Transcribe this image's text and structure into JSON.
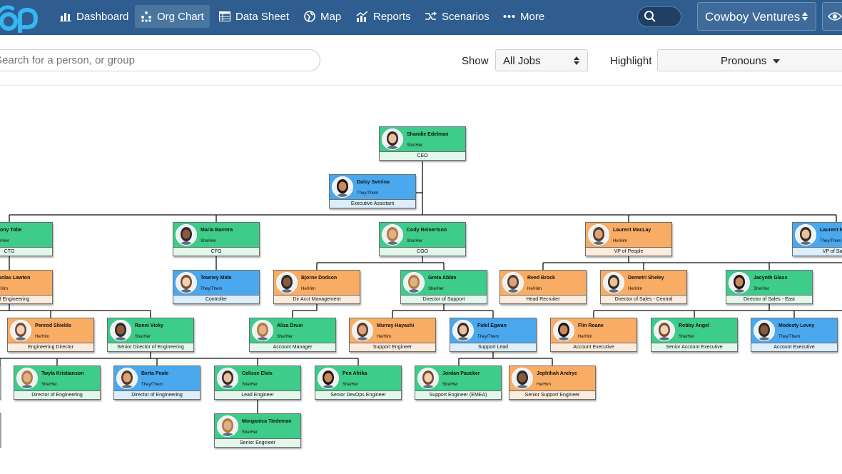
{
  "nav": {
    "items": [
      {
        "label": "Dashboard",
        "icon": "bar-chart-icon"
      },
      {
        "label": "Org Chart",
        "icon": "org-chart-icon"
      },
      {
        "label": "Data Sheet",
        "icon": "table-icon"
      },
      {
        "label": "Map",
        "icon": "globe-icon"
      },
      {
        "label": "Reports",
        "icon": "reports-icon"
      },
      {
        "label": "Scenarios",
        "icon": "scenarios-icon"
      },
      {
        "label": "More",
        "icon": "more-dots-icon"
      }
    ],
    "company": "Cowboy Ventures"
  },
  "toolbar": {
    "search_placeholder": "Search for a person, or group",
    "show_label": "Show",
    "show_value": "All Jobs",
    "highlight_label": "Highlight",
    "highlight_value": "Pronouns"
  },
  "colors": {
    "green": "#3ecc8a",
    "blue": "#4aa8ee",
    "orange": "#f9ac63",
    "topbar": "#2f5d8f"
  },
  "people": [
    {
      "id": "edelman",
      "name": "Shandie Edelman",
      "pronouns": "She/Her",
      "title": "CEO",
      "color": "green"
    },
    {
      "id": "sverina",
      "name": "Daisy Sverina",
      "pronouns": "They/Them",
      "title": "Executive Assistant",
      "color": "blue"
    },
    {
      "id": "tobe",
      "name": "Ebony Tobe",
      "pronouns": "She/Her",
      "title": "CTO",
      "color": "green"
    },
    {
      "id": "barrera",
      "name": "Maria Barrera",
      "pronouns": "She/Her",
      "title": "CFO",
      "color": "green"
    },
    {
      "id": "reinertson",
      "name": "Cody Reinertson",
      "pronouns": "She/Her",
      "title": "COO",
      "color": "green"
    },
    {
      "id": "maclay",
      "name": "Laurent MacLay",
      "pronouns": "He/Him",
      "title": "VP of People",
      "color": "orange"
    },
    {
      "id": "laurentn",
      "name": "Laurent N",
      "pronouns": "They/Them",
      "title": "VP of Sales",
      "color": "blue"
    },
    {
      "id": "lawton",
      "name": "Nikolas Lawton",
      "pronouns": "He/Him",
      "title": "VP of Engineering",
      "color": "orange"
    },
    {
      "id": "mide",
      "name": "Towney Mide",
      "pronouns": "They/Them",
      "title": "Controller",
      "color": "blue"
    },
    {
      "id": "dodson",
      "name": "Bjorne Dodson",
      "pronouns": "He/Him",
      "title": "Dir Acct Management",
      "color": "orange"
    },
    {
      "id": "abbie",
      "name": "Greta Abbie",
      "pronouns": "She/Her",
      "title": "Director of Support",
      "color": "green"
    },
    {
      "id": "brock",
      "name": "Reed Brock",
      "pronouns": "He/Him",
      "title": "Head Recruiter",
      "color": "orange"
    },
    {
      "id": "sheley",
      "name": "Demetri Sheley",
      "pronouns": "He/Him",
      "title": "Director of Sales - Central",
      "color": "orange"
    },
    {
      "id": "glass",
      "name": "Jacynth Glass",
      "pronouns": "She/Her",
      "title": "Director of Sales - East",
      "color": "green"
    },
    {
      "id": "shields",
      "name": "Penrod Shields",
      "pronouns": "He/Him",
      "title": "Engineering Director",
      "color": "orange"
    },
    {
      "id": "vicky",
      "name": "Ronni Vicky",
      "pronouns": "She/Her",
      "title": "Senior Director of Engineering",
      "color": "green"
    },
    {
      "id": "drusi",
      "name": "Aliza Drusi",
      "pronouns": "She/Her",
      "title": "Account Manager",
      "color": "green"
    },
    {
      "id": "hayashi",
      "name": "Murray Hayashi",
      "pronouns": "He/Him",
      "title": "Support Engineer",
      "color": "orange"
    },
    {
      "id": "egwan",
      "name": "Fidel Egwan",
      "pronouns": "They/Them",
      "title": "Support Lead",
      "color": "blue"
    },
    {
      "id": "roane",
      "name": "Flin Roane",
      "pronouns": "He/Him",
      "title": "Account Executive",
      "color": "orange"
    },
    {
      "id": "angel",
      "name": "Robby Angel",
      "pronouns": "She/Her",
      "title": "Senior Account Executive",
      "color": "green"
    },
    {
      "id": "levey",
      "name": "Modesty Levey",
      "pronouns": "They/Them",
      "title": "Account Executive",
      "color": "blue"
    },
    {
      "id": "kristianson",
      "name": "Twyla Kristianson",
      "pronouns": "She/Her",
      "title": "Director of Engineering",
      "color": "green"
    },
    {
      "id": "peale",
      "name": "Berta Peale",
      "pronouns": "They/Them",
      "title": "Director of Engineering",
      "color": "blue"
    },
    {
      "id": "elvis",
      "name": "Celisse Elvis",
      "pronouns": "She/Her",
      "title": "Lead Engineer",
      "color": "green"
    },
    {
      "id": "afrika",
      "name": "Pen Afrika",
      "pronouns": "She/Her",
      "title": "Senior DevOps Engineer",
      "color": "green"
    },
    {
      "id": "paucker",
      "name": "Jordan Paucker",
      "pronouns": "She/Her",
      "title": "Support Engineer (EMEA)",
      "color": "green"
    },
    {
      "id": "andryc",
      "name": "Jephthah Andryc",
      "pronouns": "He/Him",
      "title": "Senior Support Engineer",
      "color": "orange"
    },
    {
      "id": "tiedeman",
      "name": "Morganica Tiedeman",
      "pronouns": "She/Her",
      "title": "Senior Engineer",
      "color": "green"
    }
  ]
}
